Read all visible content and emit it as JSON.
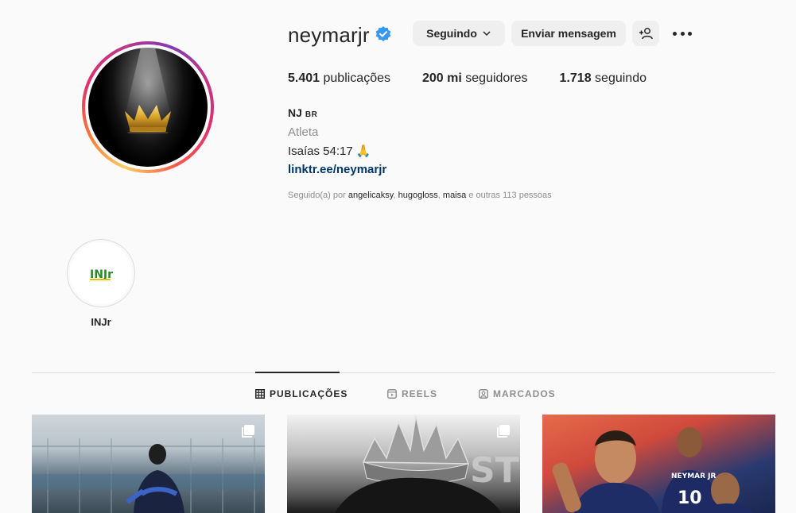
{
  "profile": {
    "username": "neymarjr",
    "verified": true,
    "buttons": {
      "following": "Seguindo",
      "message": "Enviar mensagem"
    },
    "stats": {
      "posts_count": "5.401",
      "posts_label": "publicações",
      "followers_count": "200 mi",
      "followers_label": "seguidores",
      "following_count": "1.718",
      "following_label": "seguindo"
    },
    "bio": {
      "name": "NJ",
      "flag": "BR",
      "category": "Atleta",
      "text": "Isaías 54:17 🙏",
      "link": "linktr.ee/neymarjr"
    },
    "followed_by": {
      "prefix": "Seguido(a) por ",
      "users": [
        "angelicaksy",
        "hugogloss",
        "maisa"
      ],
      "suffix": " e outras 113 pessoas"
    }
  },
  "highlights": [
    {
      "label": "INJr",
      "logo_text": "INJr"
    }
  ],
  "tabs": [
    {
      "label": "PUBLICAÇÕES",
      "icon": "grid-icon",
      "active": true
    },
    {
      "label": "REELS",
      "icon": "reels-icon",
      "active": false
    },
    {
      "label": "MARCADOS",
      "icon": "tagged-icon",
      "active": false
    }
  ],
  "posts": [
    {
      "type": "carousel"
    },
    {
      "type": "carousel"
    },
    {
      "type": "single"
    }
  ],
  "colors": {
    "verified_blue": "#3897f0",
    "link_color": "#00376b",
    "muted": "#8e8e8e",
    "button_bg": "#efefef"
  }
}
